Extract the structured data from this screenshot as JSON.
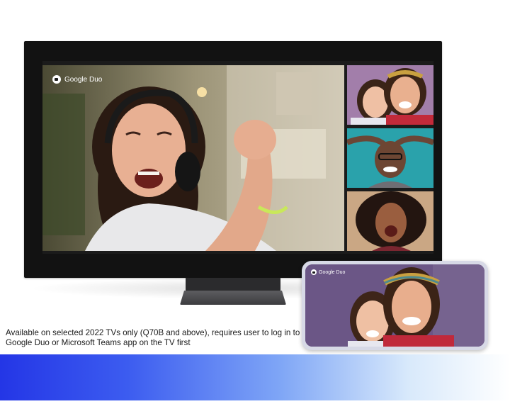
{
  "tv": {
    "app_name": "Google Duo",
    "main_caller": "singing-woman-with-headphones",
    "participants": [
      "two-smiling-women",
      "smiling-man-with-glasses",
      "laughing-woman-curly-hair"
    ]
  },
  "phone": {
    "app_name": "Google Duo",
    "caller": "two-smiling-women"
  },
  "caption": {
    "text": "Available on selected 2022 TVs only (Q70B and above), requires user to log in to Google Duo or Microsoft Teams app on the TV first"
  },
  "colors": {
    "band_start": "#2436e6",
    "band_end": "#ffffff",
    "tv_bezel": "#121212"
  }
}
